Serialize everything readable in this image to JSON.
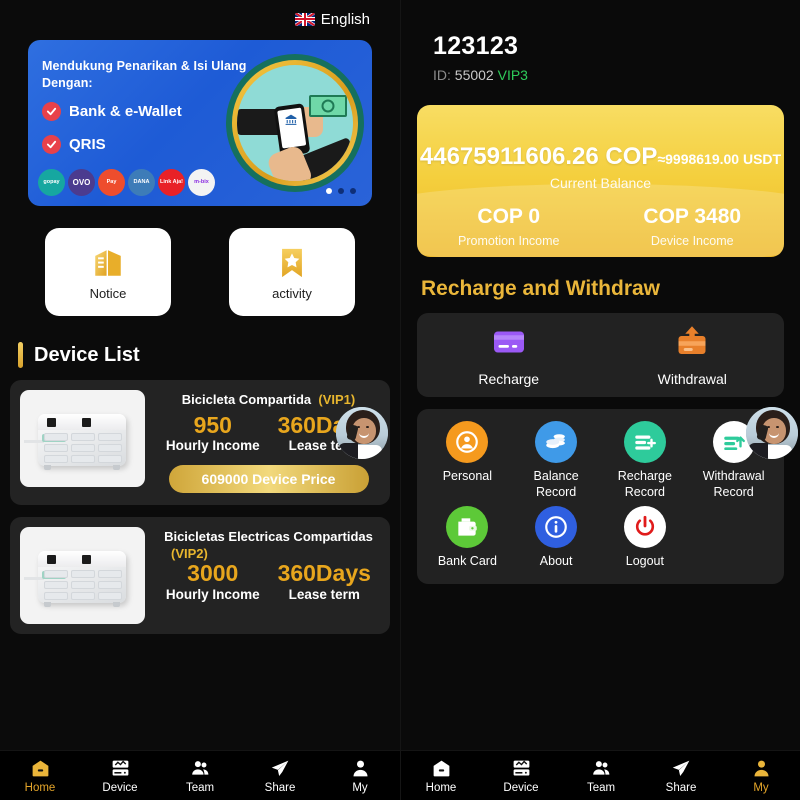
{
  "language": {
    "label": "English",
    "flag_icon": "uk-flag-icon"
  },
  "banner": {
    "headline": "Mendukung Penarikan & Isi Ulang Dengan:",
    "items": [
      "Bank & e-Wallet",
      "QRIS"
    ],
    "wallets": [
      {
        "name": "gopay",
        "color": "#16a7a0",
        "text": "gopay"
      },
      {
        "name": "OVO",
        "color": "#4b3b8f",
        "text": "OVO"
      },
      {
        "name": "ShopeePay",
        "color": "#ee4d2d",
        "text": "Pay"
      },
      {
        "name": "DANA",
        "color": "#3d7cb8",
        "text": "DANA"
      },
      {
        "name": "LinkAja",
        "color": "#e82127",
        "text": "Link Aja!"
      },
      {
        "name": "m-bix",
        "color": "#f3f3f3",
        "text": "m-bix"
      }
    ],
    "dots": {
      "count": 3,
      "active": 0
    }
  },
  "quick_tiles": [
    {
      "icon": "building-icon",
      "label": "Notice"
    },
    {
      "icon": "star-bookmark-icon",
      "label": "activity"
    }
  ],
  "device_section": {
    "title": "Device List"
  },
  "devices": [
    {
      "name": "Bicicleta Compartida",
      "vip": "(VIP1)",
      "income_value": "950",
      "income_label": "Hourly Income",
      "lease_value": "360Days",
      "lease_label": "Lease term",
      "price_label": "609000 Device Price",
      "has_price_button": true
    },
    {
      "name": "Bicicletas Electricas Compartidas",
      "vip": "(VIP2)",
      "income_value": "3000",
      "income_label": "Hourly Income",
      "lease_value": "360Days",
      "lease_label": "Lease term",
      "price_label": "",
      "has_price_button": false
    }
  ],
  "account": {
    "username": "123123",
    "id_label": "ID:",
    "id_value": "55002",
    "vip": "VIP3"
  },
  "balance": {
    "amount": "44675911606.26 COP",
    "approx": "≈9998619.00 USDT",
    "caption": "Current Balance",
    "columns": [
      {
        "value": "COP 0",
        "label": "Promotion Income"
      },
      {
        "value": "COP 3480",
        "label": "Device Income"
      }
    ],
    "accent_color": "#f4cf3d"
  },
  "recharge_section": {
    "title": "Recharge and Withdraw",
    "actions": [
      {
        "icon": "credit-card-icon",
        "label": "Recharge",
        "color": "#9b59f5"
      },
      {
        "icon": "withdraw-box-icon",
        "label": "Withdrawal",
        "color": "#e8802b"
      }
    ]
  },
  "menu_grid": [
    {
      "icon": "person-circle-icon",
      "label": "Personal",
      "color": "#f59a1e"
    },
    {
      "icon": "coins-icon",
      "label": "Balance Record",
      "color": "#3f9ae8"
    },
    {
      "icon": "list-plus-icon",
      "label": "Recharge Record",
      "color": "#2ecb9b"
    },
    {
      "icon": "list-up-icon",
      "label": "Withdrawal Record",
      "color": "#ffffff"
    },
    {
      "icon": "wallet-icon",
      "label": "Bank Card",
      "color": "#5dc938"
    },
    {
      "icon": "info-icon",
      "label": "About",
      "color": "#2f5fe0"
    },
    {
      "icon": "power-icon",
      "label": "Logout",
      "color": "#ffffff"
    }
  ],
  "bottom_nav_left": {
    "items": [
      {
        "icon": "home-icon",
        "label": "Home",
        "active": true
      },
      {
        "icon": "device-icon",
        "label": "Device",
        "active": false
      },
      {
        "icon": "team-icon",
        "label": "Team",
        "active": false
      },
      {
        "icon": "share-icon",
        "label": "Share",
        "active": false
      },
      {
        "icon": "my-icon",
        "label": "My",
        "active": false
      }
    ]
  },
  "bottom_nav_right": {
    "items": [
      {
        "icon": "home-icon",
        "label": "Home",
        "active": false
      },
      {
        "icon": "device-icon",
        "label": "Device",
        "active": false
      },
      {
        "icon": "team-icon",
        "label": "Team",
        "active": false
      },
      {
        "icon": "share-icon",
        "label": "Share",
        "active": false
      },
      {
        "icon": "my-icon",
        "label": "My",
        "active": true
      }
    ]
  },
  "support_widget": {
    "icon": "support-agent-avatar"
  }
}
